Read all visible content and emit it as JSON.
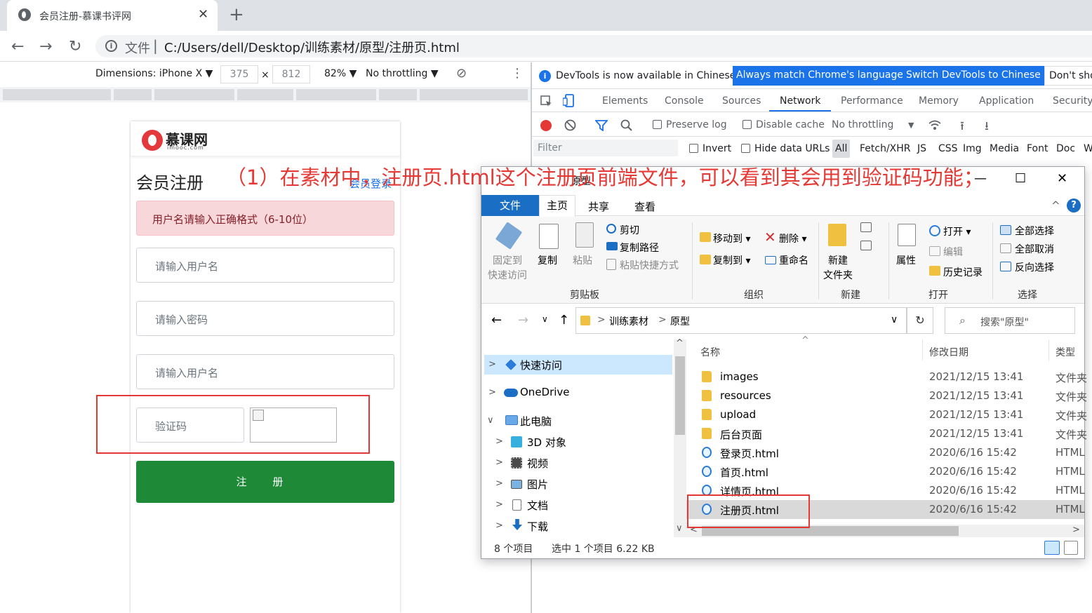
{
  "browser": {
    "tab_title": "会员注册-慕课书评网",
    "close_glyph": "✕",
    "new_tab_glyph": "+",
    "back_glyph": "←",
    "forward_glyph": "→",
    "reload_glyph": "↻",
    "info_glyph": "i",
    "protocol_label": "文件",
    "separator": "|",
    "url": "C:/Users/dell/Desktop/训练素材/原型/注册页.html"
  },
  "device_toolbar": {
    "dimensions": "Dimensions: iPhone X ▼",
    "width": "375",
    "times": "×",
    "height": "812",
    "zoom": "82% ▼",
    "throttling": "No throttling ▼",
    "rotate_glyph": "⊘",
    "more_glyph": "⋮"
  },
  "page": {
    "brand": "慕课网",
    "brand_sub": "imooc.com",
    "title": "会员注册",
    "login_link": "会员登录",
    "alert": "用户名请输入正确格式（6-10位）",
    "username_placeholder": "请输入用户名",
    "password_placeholder": "请输入密码",
    "nickname_placeholder": "请输入用户名",
    "captcha_placeholder": "验证码",
    "submit": "注 册"
  },
  "annotation": "（1）在素材中，注册页.html这个注册页前端文件，可以看到其会用到验证码功能；",
  "devtools": {
    "notice": "DevTools is now available in Chinese!",
    "btn_match": "Always match Chrome's language",
    "btn_switch": "Switch DevTools to Chinese",
    "btn_dont": "Don't sho",
    "tabs": [
      "Elements",
      "Console",
      "Sources",
      "Network",
      "Performance",
      "Memory",
      "Application",
      "Security"
    ],
    "network": {
      "preserve_log": "Preserve log",
      "disable_cache": "Disable cache",
      "throttling": "No throttling",
      "dropdown_glyph": "▼",
      "upload_glyph": "⭱",
      "download_glyph": "⭳"
    },
    "filter": {
      "placeholder": "Filter",
      "invert": "Invert",
      "hide_data": "Hide data URLs",
      "types": [
        "All",
        "Fetch/XHR",
        "JS",
        "CSS",
        "Img",
        "Media",
        "Font",
        "Doc",
        "W"
      ]
    }
  },
  "explorer": {
    "title": "原型",
    "window": {
      "min": "—",
      "max": "☐",
      "close": "✕"
    },
    "ribbon_tabs": [
      "文件",
      "主页",
      "共享",
      "查看"
    ],
    "ribbon_collapse": "^",
    "help": "?",
    "ribbon": {
      "pin": "固定到",
      "pin2": "快速访问",
      "copy": "复制",
      "paste": "粘贴",
      "cut": "剪切",
      "copy_path": "复制路径",
      "paste_shortcut": "粘贴快捷方式",
      "group_clipboard": "剪贴板",
      "move_to": "移动到 ▾",
      "copy_to": "复制到 ▾",
      "delete": "删除 ▾",
      "rename": "重命名",
      "group_organize": "组织",
      "new_folder": "新建",
      "new_folder2": "文件夹",
      "group_new": "新建",
      "properties": "属性",
      "open": "打开 ▾",
      "edit": "编辑",
      "history": "历史记录",
      "group_open": "打开",
      "select_all": "全部选择",
      "select_none": "全部取消",
      "invert": "反向选择",
      "group_select": "选择"
    },
    "address": {
      "back": "←",
      "forward": "→",
      "down": "∨",
      "up": "↑",
      "crumb_sep": ">",
      "crumb1": "训练素材",
      "crumb2": "原型",
      "dropdown": "∨",
      "refresh": "↻",
      "search_glyph": "⌕",
      "search": "搜索\"原型\""
    },
    "nav": {
      "expand": ">",
      "collapse": "∨",
      "quick": "快速访问",
      "onedrive": "OneDrive",
      "pc": "此电脑",
      "obj3d": "3D 对象",
      "video": "视频",
      "pictures": "图片",
      "docs": "文档",
      "downloads": "下载"
    },
    "scroll": {
      "up": "^",
      "down": "∨",
      "left": "<",
      "right": ">"
    },
    "columns": {
      "sort": "^",
      "name": "名称",
      "date": "修改日期",
      "type": "类型"
    },
    "files": [
      {
        "name": "images",
        "date": "2021/12/15 13:41",
        "type": "文件夹",
        "kind": "folder"
      },
      {
        "name": "resources",
        "date": "2021/12/15 13:41",
        "type": "文件夹",
        "kind": "folder"
      },
      {
        "name": "upload",
        "date": "2021/12/15 13:41",
        "type": "文件夹",
        "kind": "folder"
      },
      {
        "name": "后台页面",
        "date": "2021/12/15 13:41",
        "type": "文件夹",
        "kind": "folder"
      },
      {
        "name": "登录页.html",
        "date": "2020/6/16 15:42",
        "type": "HTML",
        "kind": "htm"
      },
      {
        "name": "首页.html",
        "date": "2020/6/16 15:42",
        "type": "HTML",
        "kind": "htm"
      },
      {
        "name": "详情页.html",
        "date": "2020/6/16 15:42",
        "type": "HTML",
        "kind": "htm"
      },
      {
        "name": "注册页.html",
        "date": "2020/6/16 15:42",
        "type": "HTML",
        "kind": "htm"
      }
    ],
    "status": {
      "count": "8 个项目",
      "selected": "选中 1 个项目  6.22 KB"
    }
  }
}
